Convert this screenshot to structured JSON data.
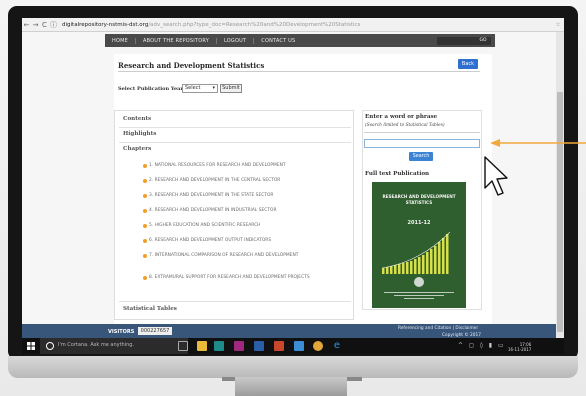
{
  "browser": {
    "url_host": "digitalrepository-nstmis-dst.org",
    "url_path": "/adv_search.php?type_doc=Research%20and%20Development%20Statistics",
    "back_icon": "arrow-left-icon",
    "forward_icon": "arrow-right-icon",
    "reload_icon": "reload-icon",
    "info_icon": "info-icon",
    "star_icon": "star-icon"
  },
  "nav": {
    "items": [
      "HOME",
      "ABOUT THE REPOSITORY",
      "LOGOUT",
      "CONTACT US"
    ],
    "go_label": "GO"
  },
  "page": {
    "title": "Research and Development Statistics",
    "back_label": "Back",
    "year_label": "Select Publication Year :",
    "year_value": "Select",
    "submit_label": "Submit"
  },
  "left_panel": {
    "contents": "Contents",
    "highlights": "Highlights",
    "chapters": "Chapters",
    "chapter_items": [
      "1. NATIONAL RESOURCES FOR RESEARCH AND DEVELOPMENT",
      "2. RESEARCH AND DEVELOPMENT IN THE CENTRAL SECTOR",
      "3. RESEARCH AND DEVELOPMENT IN THE STATE SECTOR",
      "4. RESEARCH AND DEVELOPMENT IN INDUSTRIAL SECTOR",
      "5. HIGHER EDUCATION AND SCIENTIFIC RESEARCH",
      "6. RESEARCH AND DEVELOPMENT OUTPUT INDICATORS",
      "7. INTERNATIONAL COMPARISON OF RESEARCH AND DEVELOPMENT",
      "8. EXTRAMURAL SUPPORT FOR RESEARCH AND DEVELOPMENT PROJECTS"
    ],
    "statistical_tables": "Statistical Tables"
  },
  "right_panel": {
    "heading": "Enter a word or phrase",
    "subheading": "(Search limited to Statistical Tables)",
    "input_value": "",
    "search_label": "Search",
    "fulltext_heading": "Full text Publication",
    "cover_title_line1": "RESEARCH AND DEVELOPMENT",
    "cover_title_line2": "STATISTICS",
    "cover_year": "2011-12"
  },
  "footer": {
    "visitors_label": "VISITORS",
    "visitor_count": "000227657",
    "links": "Referencing and Citation | Disclaimer",
    "copyright": "Copyright © 2017"
  },
  "taskbar": {
    "cortana_placeholder": "I'm Cortana. Ask me anything.",
    "time": "17:06",
    "date": "16-11-2017"
  },
  "colors": {
    "nav_bg": "#4a4a4a",
    "accent_blue": "#2f6fcf",
    "footer_bg": "#38557a",
    "bullet_orange": "#f0a02a",
    "annotation_arrow": "#f2a93b",
    "cover_green": "#2f5e2f"
  }
}
